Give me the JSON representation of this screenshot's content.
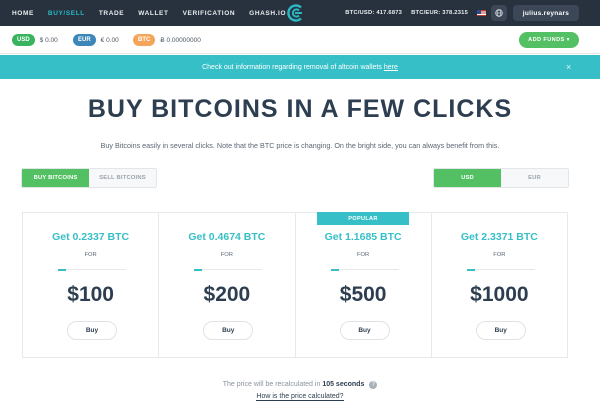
{
  "nav": {
    "items": [
      {
        "label": "HOME",
        "active": false
      },
      {
        "label": "BUY/SELL",
        "active": true
      },
      {
        "label": "TRADE",
        "active": false
      },
      {
        "label": "WALLET",
        "active": false
      },
      {
        "label": "VERIFICATION",
        "active": false
      },
      {
        "label": "GHASH.IO",
        "active": false
      }
    ],
    "rates": {
      "btc_usd": "BTC/USD: 417.6873",
      "btc_eur": "BTC/EUR: 378.2315"
    },
    "username": "julius.reynars"
  },
  "balances": [
    {
      "currency": "USD",
      "amount": "$ 0.00",
      "color": "#3ab35e"
    },
    {
      "currency": "EUR",
      "amount": "€ 0.00",
      "color": "#3c86b8"
    },
    {
      "currency": "BTC",
      "amount": "Ƀ 0.00000000",
      "color": "#f4a55a"
    }
  ],
  "add_funds_label": "ADD FUNDS ▾",
  "alert": {
    "text": "Check out information regarding removal of altcoin wallets",
    "link": "here",
    "close": "×"
  },
  "page_title": "BUY BITCOINS IN A FEW CLICKS",
  "subtitle": "Buy Bitcoins easily in several clicks. Note that the BTC price is changing. On the bright side, you can always benefit from this.",
  "mode_toggle": {
    "buy": "BUY BITCOINS",
    "sell": "SELL BITCOINS",
    "selected": "buy"
  },
  "currency_toggle": {
    "usd": "USD",
    "eur": "EUR",
    "selected": "usd"
  },
  "popular_label": "POPULAR",
  "packages": [
    {
      "get": "Get 0.2337 BTC",
      "for": "FOR",
      "price": "$100",
      "buy": "Buy",
      "slider_fraction": 0.12
    },
    {
      "get": "Get 0.4674 BTC",
      "for": "FOR",
      "price": "$200",
      "buy": "Buy",
      "slider_fraction": 0.12
    },
    {
      "get": "Get 1.1685 BTC",
      "for": "FOR",
      "price": "$500",
      "buy": "Buy",
      "slider_fraction": 0.12
    },
    {
      "get": "Get 2.3371 BTC",
      "for": "FOR",
      "price": "$1000",
      "buy": "Buy",
      "slider_fraction": 0.12
    }
  ],
  "recalc": {
    "prefix": "The price will be recalculated in",
    "time": "105 seconds",
    "help_icon": "?"
  },
  "how_link": "How is the price calculated?",
  "colors": {
    "accent": "#36bfc7",
    "green": "#52c063",
    "nav_bg": "#27323e"
  }
}
